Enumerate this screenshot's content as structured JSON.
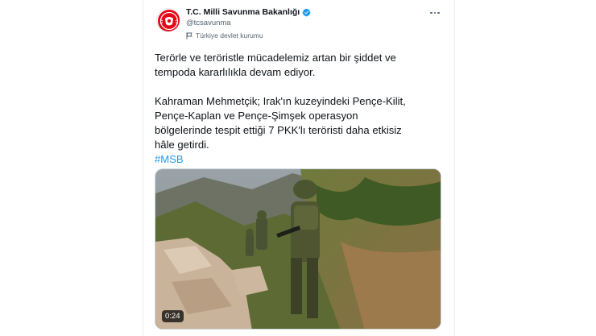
{
  "tweet": {
    "author": {
      "display_name": "T.C. Milli Savunma Bakanlığı",
      "handle": "@tcsavunma",
      "account_label": "Türkiye devlet kurumu",
      "verified_color": "#1d9bf0",
      "avatar_icon": "msb-emblem-icon",
      "label_icon": "flag-icon"
    },
    "text": {
      "para1_line1": "Terörle ve teröristle mücadelemiz artan bir şiddet ve",
      "para1_line2": "tempoda kararlılıkla devam ediyor.",
      "para2_line1": "Kahraman Mehmetçik; Irak'ın kuzeyindeki Pençe-Kilit,",
      "para2_line2": "Pençe-Kaplan ve Pençe-Şimşek operasyon",
      "para2_line3": "bölgelerinde tespit ettiği 7 PKK'lı teröristi daha etkisiz",
      "para2_line4": "hâle getirdi.",
      "hashtag": "#MSB"
    },
    "media": {
      "type": "video",
      "duration": "0:24"
    },
    "colors": {
      "link": "#1d9bf0",
      "secondary_text": "#536471",
      "emblem_red": "#e30a17"
    }
  }
}
